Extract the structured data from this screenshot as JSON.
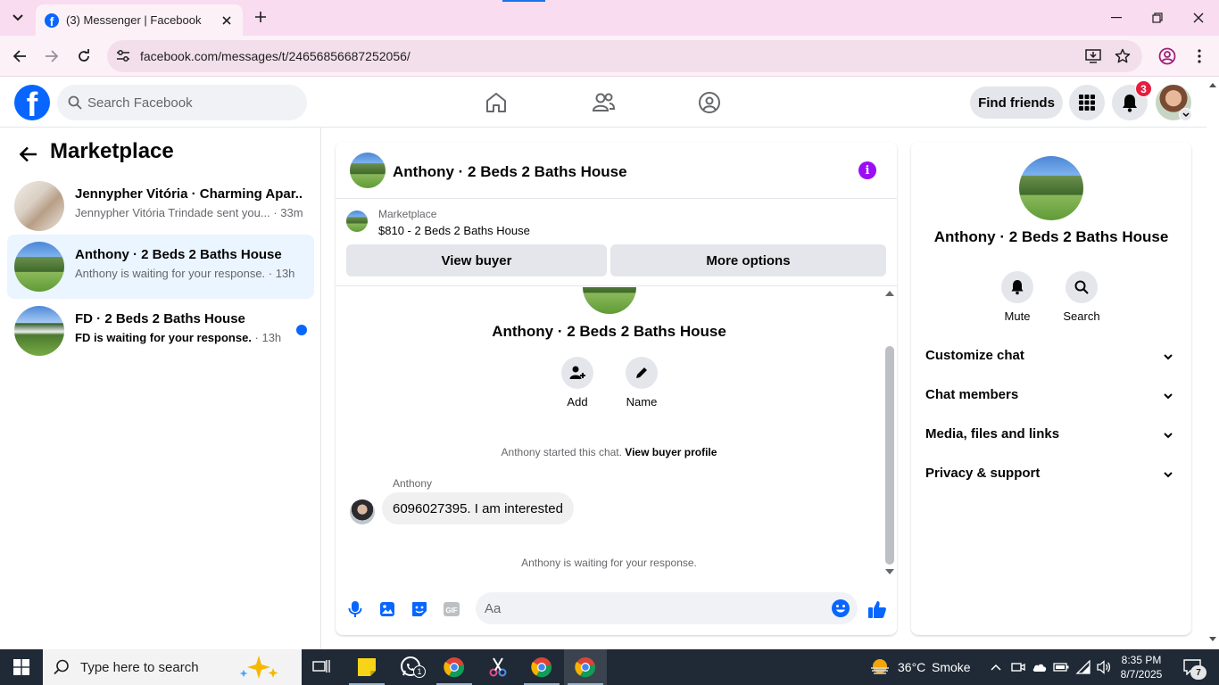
{
  "browser": {
    "tab_title": "(3) Messenger | Facebook",
    "url": "facebook.com/messages/t/24656856687252056/"
  },
  "header": {
    "search_placeholder": "Search Facebook",
    "find_friends": "Find friends",
    "notification_count": "3"
  },
  "sidebar": {
    "title": "Marketplace",
    "conversations": [
      {
        "name": "Jennypher Vitória · Charming Apar...",
        "preview": "Jennypher Vitória Trindade sent you...",
        "time": " · 33m",
        "unread": false,
        "active": false
      },
      {
        "name": "Anthony · 2 Beds 2 Baths House",
        "preview": "Anthony is waiting for your response.",
        "time": " · 13h",
        "unread": false,
        "active": true
      },
      {
        "name": "FD · 2 Beds 2 Baths House",
        "preview": "FD is waiting for your response.",
        "time": " · 13h",
        "unread": true,
        "active": false
      }
    ]
  },
  "chat": {
    "title": "Anthony · 2 Beds 2 Baths House",
    "marketplace_label": "Marketplace",
    "listing": "$810 - 2 Beds 2 Baths House",
    "view_buyer": "View buyer",
    "more_options": "More options",
    "profile_name": "Anthony · 2 Beds 2 Baths House",
    "add_label": "Add",
    "name_label": "Name",
    "started_text": "Anthony started this chat. ",
    "view_buyer_profile": "View buyer profile",
    "sender": "Anthony",
    "message": "6096027395. I am interested",
    "waiting": "Anthony is waiting for your response.",
    "composer_placeholder": "Aa"
  },
  "info_panel": {
    "name": "Anthony · 2 Beds 2 Baths House",
    "mute": "Mute",
    "search": "Search",
    "sections": [
      "Customize chat",
      "Chat members",
      "Media, files and links",
      "Privacy & support"
    ]
  },
  "taskbar": {
    "search_label": "Type here to search",
    "weather_temp": "36°C",
    "weather_desc": "Smoke",
    "time": "8:35 PM",
    "date": "8/7/2025",
    "notification_count": "7",
    "whatsapp_badge": "1"
  },
  "colors": {
    "accent": "#0866ff",
    "messenger_purple": "#9b0ef4",
    "chrome_tab_bg": "#f9dcef",
    "unread_dot": "#0866ff",
    "badge_red": "#e41e3f"
  }
}
